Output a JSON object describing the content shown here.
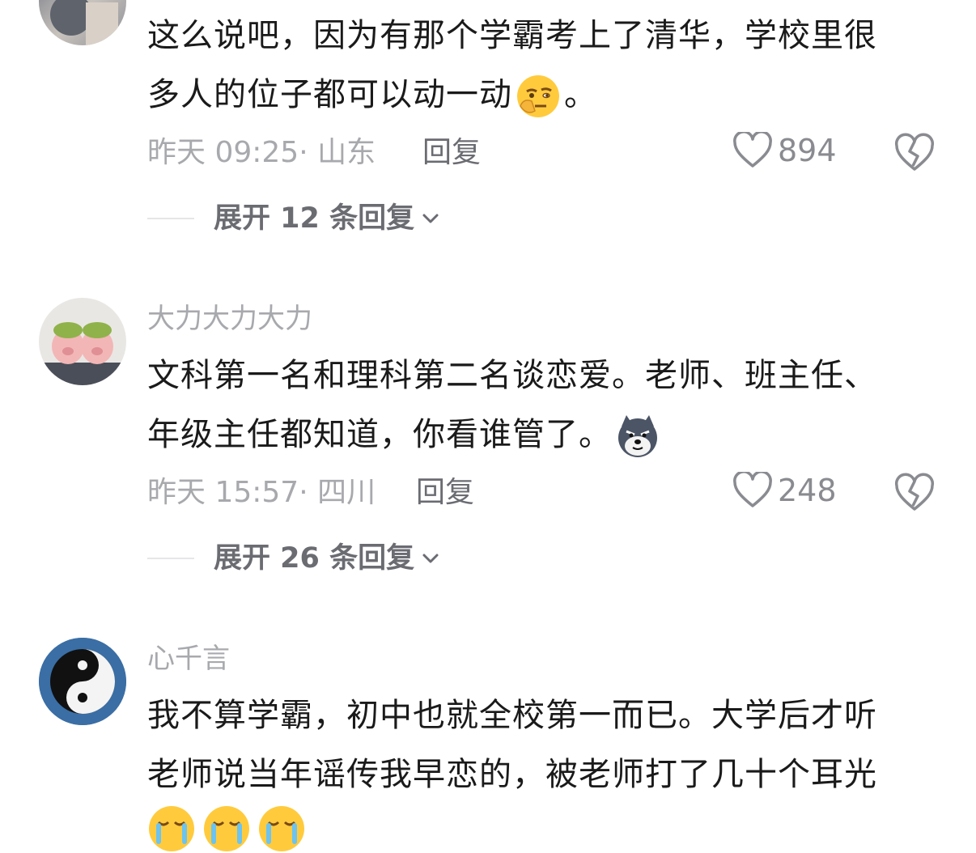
{
  "comments": [
    {
      "username": "",
      "text_line1": "这么说吧，因为有那个学霸考上了清华，学校里很",
      "text_line2": "多人的位子都可以动一动",
      "text_end": "。",
      "emoji": "thinking-emoji",
      "time": "昨天 09:25· 山东",
      "reply_label": "回复",
      "likes": "894",
      "expand_label": "展开 12 条回复"
    },
    {
      "username": "大力大力大力",
      "text_line1": "文科第一名和理科第二名谈恋爱。老师、班主任、",
      "text_line2": "年级主任都知道，你看谁管了。",
      "text_end": "",
      "emoji": "husky-emoji",
      "time": "昨天 15:57· 四川",
      "reply_label": "回复",
      "likes": "248",
      "expand_label": "展开 26 条回复"
    },
    {
      "username": "心千言",
      "text_line1": "我不算学霸，初中也就全校第一而已。大学后才听",
      "text_line2": "老师说当年谣传我早恋的，被老师打了几十个耳光",
      "emoji": "crying-emoji"
    }
  ],
  "colors": {
    "meta": "#a8a9ad",
    "text": "#1a1a1a",
    "reply": "#6b6c72"
  }
}
